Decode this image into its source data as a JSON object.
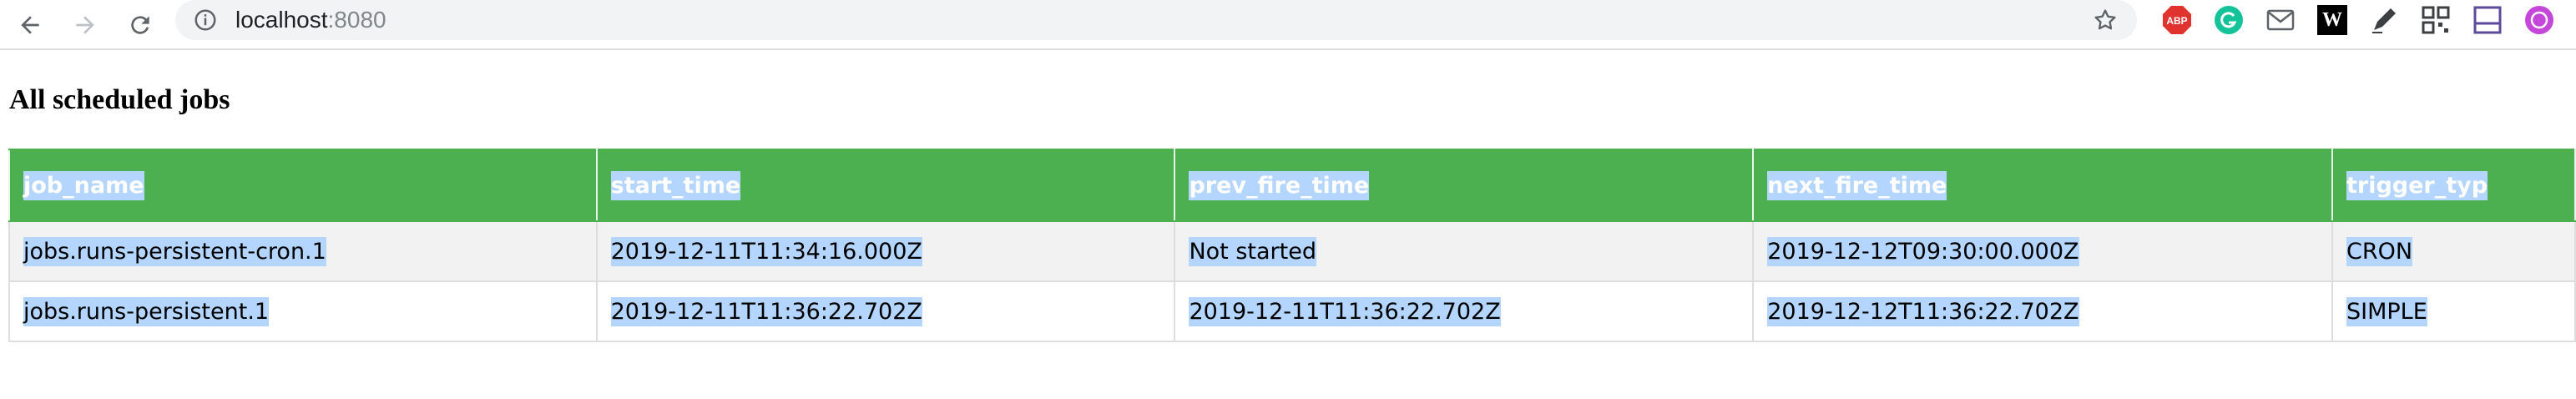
{
  "browser": {
    "url_host": "localhost",
    "url_port": ":8080",
    "extensions": [
      "adblock-icon",
      "grammarly-icon",
      "mail-icon",
      "wikiwand-icon",
      "pen-icon",
      "qr-icon",
      "notes-icon",
      "profile-icon"
    ],
    "extension_labels": {
      "adblock": "ABP",
      "wikiwand": "W"
    }
  },
  "page": {
    "title": "All scheduled jobs"
  },
  "table": {
    "headers": [
      "job_name",
      "start_time",
      "prev_fire_time",
      "next_fire_time",
      "trigger_typ"
    ],
    "rows": [
      [
        "jobs.runs-persistent-cron.1",
        "2019-12-11T11:34:16.000Z",
        "Not started",
        "2019-12-12T09:30:00.000Z",
        "CRON"
      ],
      [
        "jobs.runs-persistent.1",
        "2019-12-11T11:36:22.702Z",
        "2019-12-11T11:36:22.702Z",
        "2019-12-12T11:36:22.702Z",
        "SIMPLE"
      ]
    ]
  },
  "colors": {
    "header_bg": "#4caf50",
    "selection": "#b4d5fe",
    "odd_row_bg": "#f2f2f2"
  }
}
